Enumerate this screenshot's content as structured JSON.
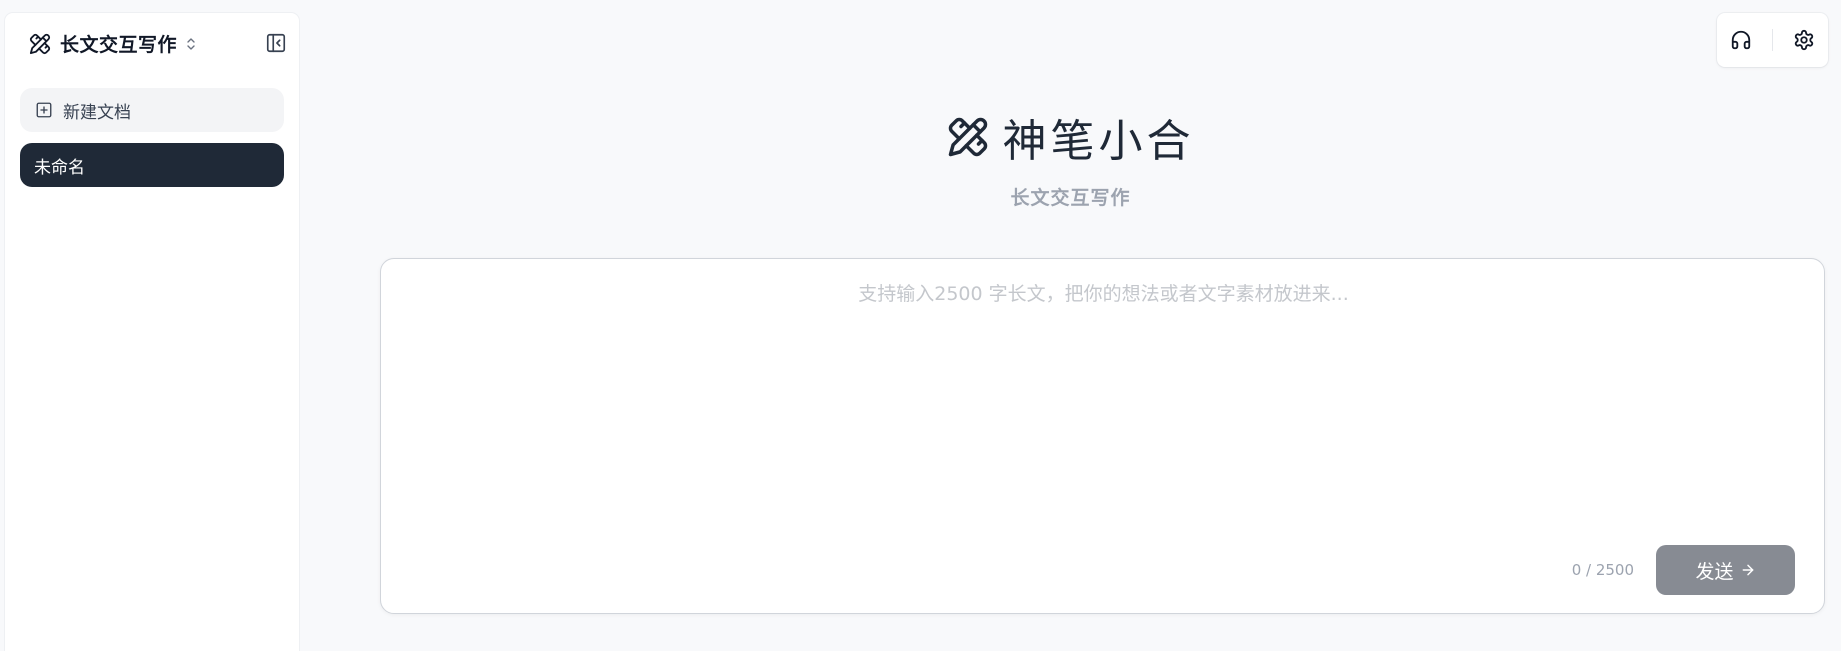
{
  "app": {
    "brand_title": "长文交互写作",
    "brand_icon": "pencil-ruler-icon"
  },
  "sidebar": {
    "new_doc_label": "新建文档",
    "documents": [
      {
        "label": "未命名",
        "active": true
      }
    ]
  },
  "toolbar": {
    "icons": [
      "headset-icon",
      "gear-icon"
    ]
  },
  "hero": {
    "title": "神笔小合",
    "subtitle": "长文交互写作"
  },
  "composer": {
    "placeholder": "支持输入2500 字长文，把你的想法或者文字素材放进来...",
    "value": "",
    "counter": "0 / 2500",
    "send_label": "发送"
  },
  "colors": {
    "active_item_bg": "#1f2937",
    "send_button_bg": "#878b93",
    "page_bg": "#f8f9fb"
  }
}
